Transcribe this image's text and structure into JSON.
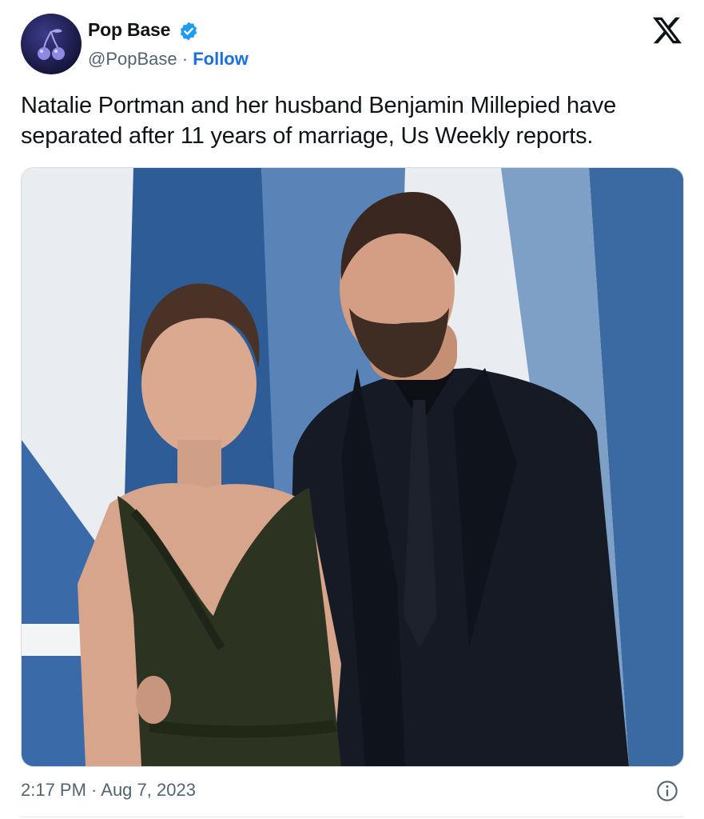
{
  "author": {
    "name": "Pop Base",
    "handle": "@PopBase",
    "separator": "·",
    "follow_label": "Follow",
    "verified_icon": "verified-badge-icon",
    "avatar_icon": "cherry-logo-icon"
  },
  "brand_icon": "x-logo-icon",
  "tweet": {
    "text": "Natalie Portman and her husband Benjamin Millepied have separated after 11 years of marriage, Us Weekly reports.",
    "timestamp": "2:17 PM · Aug 7, 2023"
  },
  "colors": {
    "link": "#1d6fe0",
    "verified": "#1d9bf0",
    "muted_text": "#536471",
    "primary_text": "#0f1419"
  }
}
